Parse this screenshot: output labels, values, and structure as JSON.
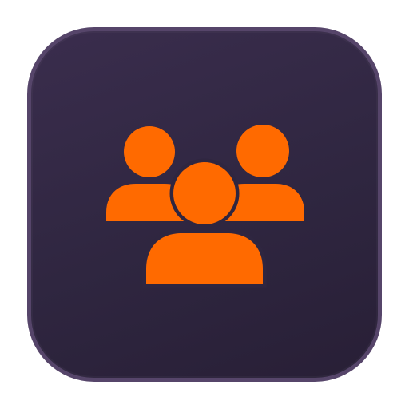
{
  "icon": {
    "name": "group-users-icon",
    "tile_background": "#2f2640",
    "tile_border": "#56456a",
    "glyph_color": "#ff6a00",
    "glyph_outline": "#2f2640"
  }
}
